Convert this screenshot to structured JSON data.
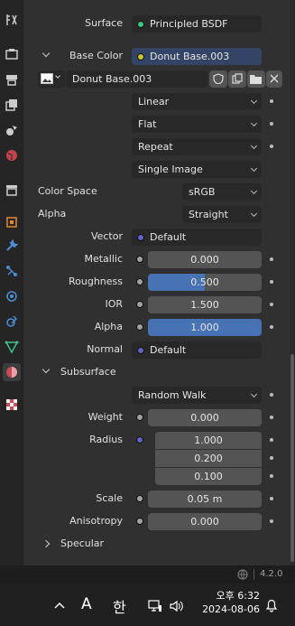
{
  "properties": {
    "surface": {
      "label": "Surface",
      "value": "Principled BSDF"
    },
    "base_color": {
      "label": "Base Color",
      "value": "Donut Base.003"
    },
    "image": {
      "name": "Donut Base.003"
    },
    "interpolation": "Linear",
    "projection": "Flat",
    "extension": "Repeat",
    "source": "Single Image",
    "color_space": {
      "label": "Color Space",
      "value": "sRGB"
    },
    "alpha_mode": {
      "label": "Alpha",
      "value": "Straight"
    },
    "vector": {
      "label": "Vector",
      "value": "Default"
    },
    "metallic": {
      "label": "Metallic",
      "value": "0.000",
      "fraction": 0.0
    },
    "roughness": {
      "label": "Roughness",
      "value": "0.500",
      "fraction": 0.5
    },
    "ior": {
      "label": "IOR",
      "value": "1.500",
      "fraction": 0.0
    },
    "alpha": {
      "label": "Alpha",
      "value": "1.000",
      "fraction": 1.0
    },
    "normal": {
      "label": "Normal",
      "value": "Default"
    },
    "subsurface": {
      "label": "Subsurface",
      "method": "Random Walk",
      "weight": {
        "label": "Weight",
        "value": "0.000"
      },
      "radius": {
        "label": "Radius",
        "values": [
          "1.000",
          "0.200",
          "0.100"
        ]
      },
      "scale": {
        "label": "Scale",
        "value": "0.05 m"
      },
      "anisotropy": {
        "label": "Anisotropy",
        "value": "0.000"
      }
    },
    "specular": {
      "label": "Specular"
    }
  },
  "status": {
    "version": "4.2.0"
  },
  "taskbar": {
    "ime": "A",
    "lang": "한",
    "ampm": "오후",
    "time": "6:32",
    "date": "2024-08-06"
  },
  "colors": {
    "socket_shader": "#39c884",
    "socket_color": "#c7c729",
    "socket_vector": "#6363c7",
    "socket_float": "#a1a1a1",
    "accent": "#4772b3"
  }
}
